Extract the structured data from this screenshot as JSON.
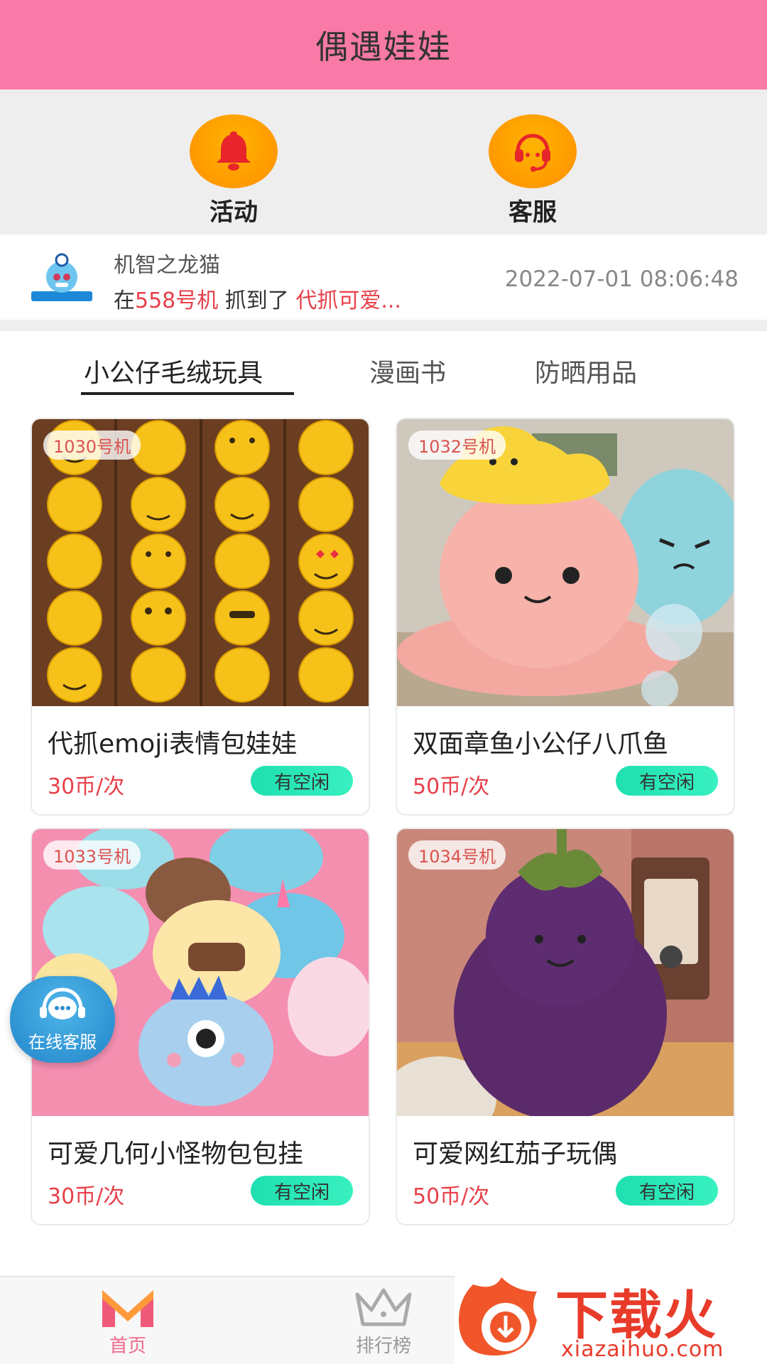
{
  "header": {
    "title": "偶遇娃娃"
  },
  "actions": {
    "activity_label": "活动",
    "service_label": "客服"
  },
  "ticker": {
    "user": "机智之龙猫",
    "prefix": "在",
    "machine": "558号机",
    "middle": " 抓到了 ",
    "prize": "代抓可爱...",
    "time": "2022-07-01 08:06:48"
  },
  "tabs": [
    "小公仔毛绒玩具",
    "漫画书",
    "防晒用品"
  ],
  "products": [
    {
      "machine": "1030号机",
      "name": "代抓emoji表情包娃娃",
      "price": "30币/次",
      "status": "有空闲"
    },
    {
      "machine": "1032号机",
      "name": "双面章鱼小公仔八爪鱼",
      "price": "50币/次",
      "status": "有空闲"
    },
    {
      "machine": "1033号机",
      "name": "可爱几何小怪物包包挂",
      "price": "30币/次",
      "status": "有空闲"
    },
    {
      "machine": "1034号机",
      "name": "可爱网红茄子玩偶",
      "price": "50币/次",
      "status": "有空闲"
    }
  ],
  "float_service": {
    "label": "在线客服"
  },
  "nav": {
    "home": "首页",
    "rank": "排行榜"
  },
  "watermark": {
    "text": "下载火",
    "url": "xiazaihuo.com"
  },
  "colors": {
    "header": "#f97aa6",
    "accent_red": "#e8404a",
    "status_green": "#1fe0b0",
    "action_orange": "#ff9900"
  }
}
